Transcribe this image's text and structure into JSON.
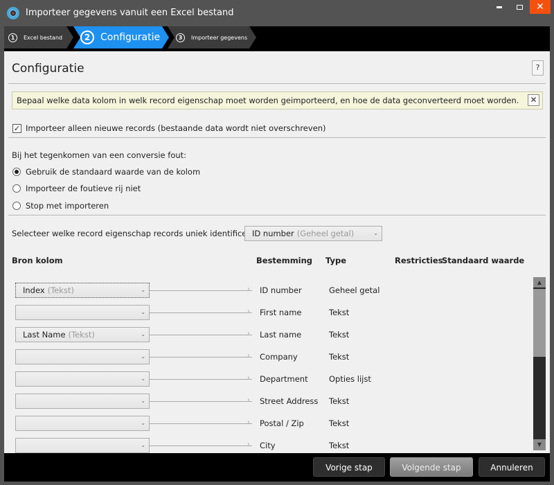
{
  "window": {
    "title": "Importeer gegevens vanuit een Excel bestand",
    "controls": {
      "minimize": "minimize",
      "maximize": "maximize",
      "close": "✕"
    }
  },
  "steps": [
    {
      "number": "1",
      "label": "Excel bestand",
      "active": false
    },
    {
      "number": "2",
      "label": "Configuratie",
      "active": true
    },
    {
      "number": "3",
      "label": "Importeer gegevens",
      "active": false
    }
  ],
  "page": {
    "title": "Configuratie",
    "help_label": "?",
    "info_text": "Bepaal welke data kolom in welk record eigenschap moet worden geimporteerd, en hoe de data geconverteerd moet worden.",
    "info_close": "✕",
    "import_only_new": {
      "label": "Importeer alleen nieuwe records (bestaande data wordt niet overschreven)",
      "checked": true,
      "check_glyph": "✓"
    },
    "conversion_error": {
      "label": "Bij het tegenkomen van een conversie fout:",
      "options": [
        {
          "label": "Gebruik de standaard waarde van de kolom",
          "selected": true
        },
        {
          "label": "Importeer de foutieve rij niet",
          "selected": false
        },
        {
          "label": "Stop met importeren",
          "selected": false
        }
      ]
    },
    "unique_identifier": {
      "label": "Selecteer welke record eigenschap records uniek identificeert:",
      "value": "ID number",
      "value_type": "(Geheel getal)"
    },
    "columns": {
      "source": "Bron kolom",
      "destination": "Bestemming",
      "type": "Type",
      "restrictions": "Restricties",
      "default_value": "Standaard waarde"
    },
    "mappings": [
      {
        "source": "Index",
        "source_type": "(Tekst)",
        "destination": "ID number",
        "type": "Geheel getal"
      },
      {
        "source": "",
        "source_type": "",
        "destination": "First name",
        "type": "Tekst"
      },
      {
        "source": "Last Name",
        "source_type": "(Tekst)",
        "destination": "Last name",
        "type": "Tekst"
      },
      {
        "source": "",
        "source_type": "",
        "destination": "Company",
        "type": "Tekst"
      },
      {
        "source": "",
        "source_type": "",
        "destination": "Department",
        "type": "Opties lijst"
      },
      {
        "source": "",
        "source_type": "",
        "destination": "Street Address",
        "type": "Tekst"
      },
      {
        "source": "",
        "source_type": "",
        "destination": "Postal / Zip",
        "type": "Tekst"
      },
      {
        "source": "",
        "source_type": "",
        "destination": "City",
        "type": "Tekst"
      }
    ],
    "chevron_glyph": "⌄",
    "arrow_glyph": "›"
  },
  "footer": {
    "prev_label": "Vorige stap",
    "next_label": "Volgende stap",
    "cancel_label": "Annuleren"
  },
  "colors": {
    "accent": "#1e90f0",
    "close": "#f5500e",
    "frame": "#535353",
    "info_bg": "#f5f5dc"
  }
}
